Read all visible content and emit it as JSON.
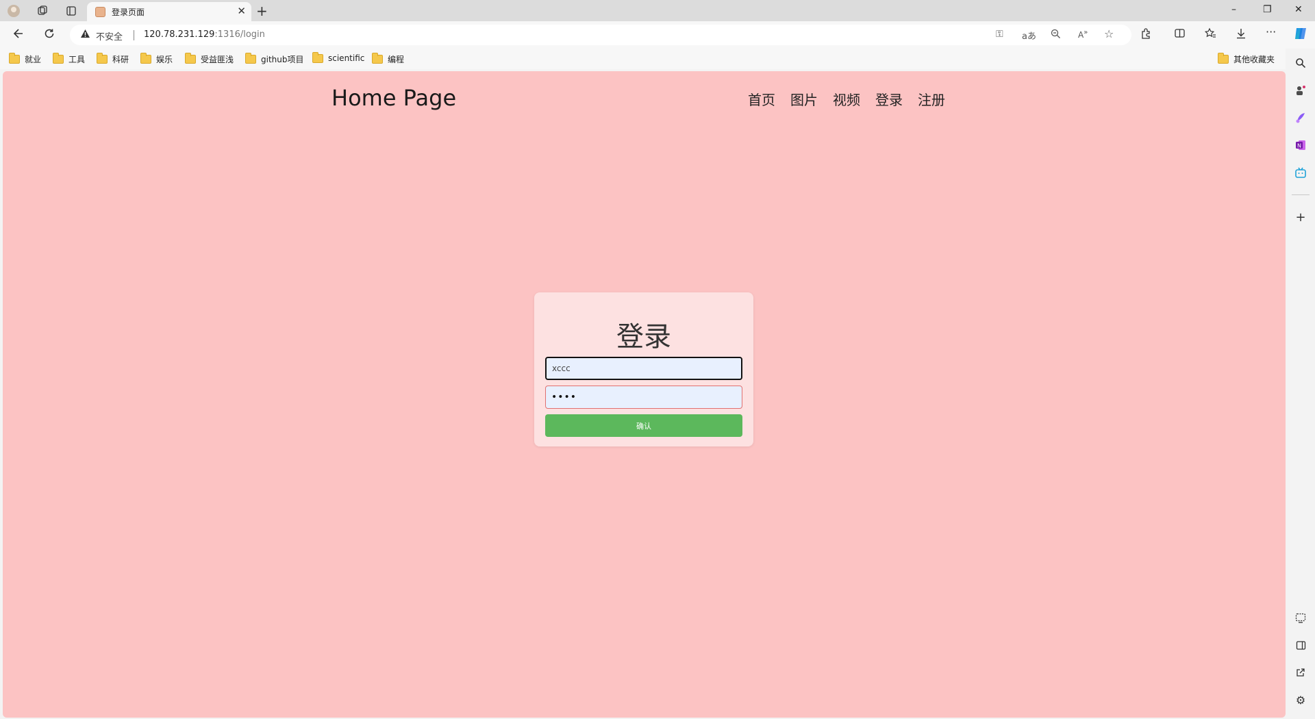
{
  "browser": {
    "tab_title": "登录页面",
    "tab_close": "✕",
    "new_tab": "+",
    "window_controls": [
      "–",
      "❐",
      "✕"
    ],
    "not_secure": "不安全",
    "url_host": "120.78.231.129",
    "url_rest": ":1316/login",
    "favorites": [
      "就业",
      "工具",
      "科研",
      "娱乐",
      "受益匪浅",
      "github项目",
      "scientific",
      "编程"
    ],
    "other_favorites": "其他收藏夹"
  },
  "site": {
    "title": "Home Page",
    "nav": [
      "首页",
      "图片",
      "视频",
      "登录",
      "注册"
    ]
  },
  "login": {
    "heading": "登录",
    "username_value": "xccc",
    "password_value": "••••",
    "submit_label": "确认"
  },
  "colors": {
    "page_bg": "#fcc3c3",
    "card_bg": "#fde1e1",
    "submit_bg": "#5cb85c",
    "input_bg": "#e8f0fe"
  },
  "icons": [
    "workspace-icon",
    "collections-icon",
    "tab-actions-icon",
    "back-icon",
    "refresh-icon",
    "warning-icon",
    "password-key-icon",
    "translate-icon",
    "zoom-out-icon",
    "read-aloud-icon",
    "favorite-star-icon",
    "extensions-icon",
    "split-screen-icon",
    "favorites-icon",
    "downloads-icon",
    "more-icon",
    "copilot-icon",
    "search-icon",
    "games-icon",
    "designer-icon",
    "onenote-icon",
    "bilibili-icon",
    "add-icon",
    "screenshot-icon",
    "sidebar-toggle-icon",
    "external-link-icon",
    "settings-icon"
  ]
}
